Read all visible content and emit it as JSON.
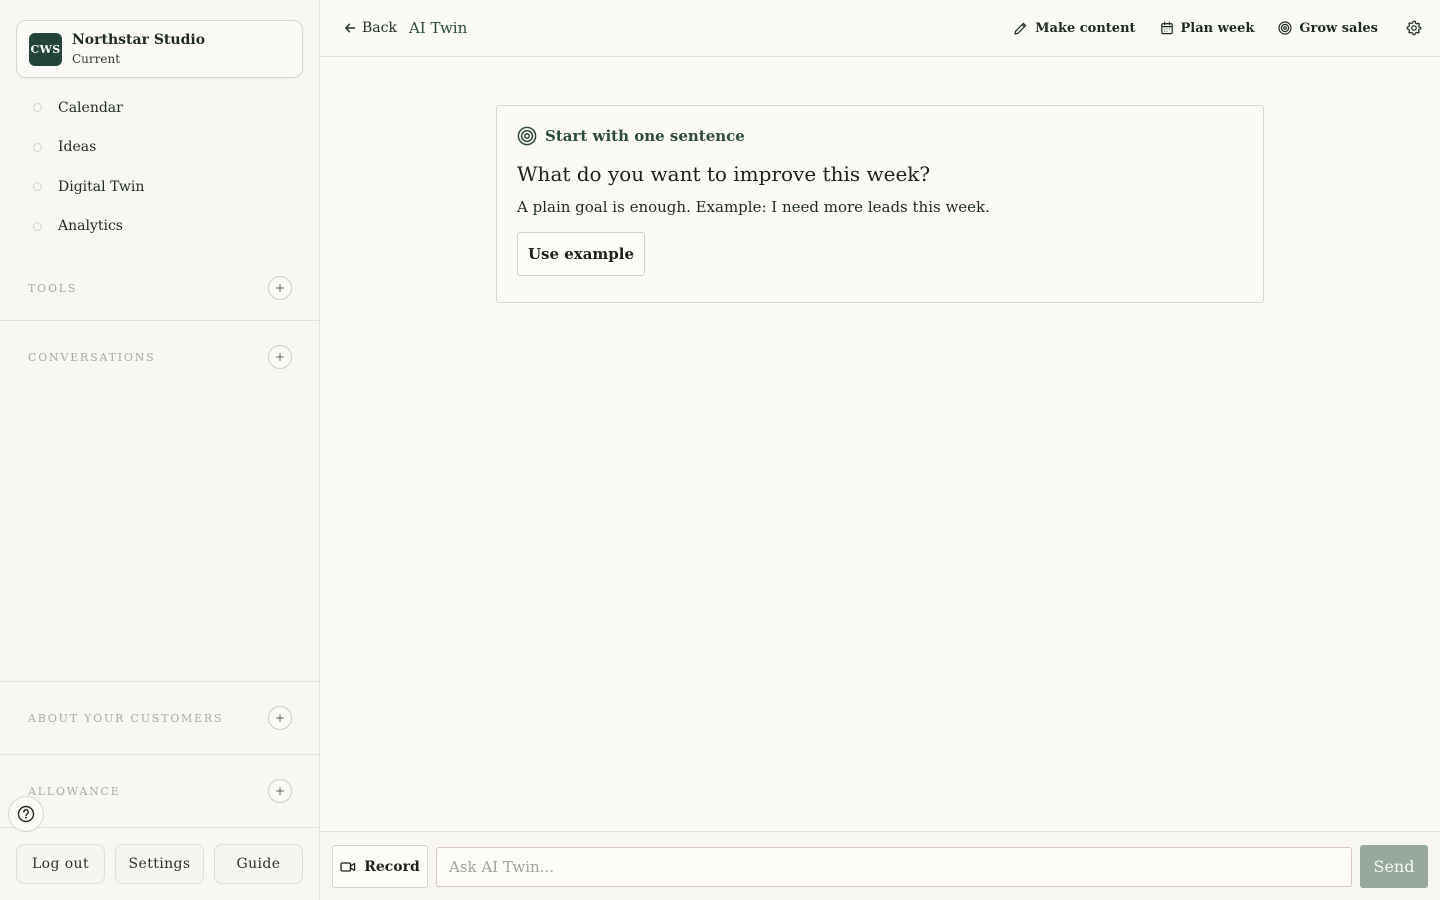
{
  "workspace": {
    "initials": "CWS",
    "name": "Northstar Studio",
    "status": "Current"
  },
  "nav": {
    "items": [
      {
        "label": "Calendar"
      },
      {
        "label": "Ideas"
      },
      {
        "label": "Digital Twin"
      },
      {
        "label": "Analytics"
      }
    ]
  },
  "sections": {
    "tools": "TOOLS",
    "conversations": "CONVERSATIONS",
    "customers": "ABOUT YOUR CUSTOMERS",
    "allowance": "ALLOWANCE",
    "plus": "+"
  },
  "footer": {
    "logout": "Log out",
    "settings": "Settings",
    "guide": "Guide"
  },
  "topbar": {
    "back": "Back",
    "title": "AI Twin",
    "actions": {
      "make_content": "Make content",
      "plan_week": "Plan week",
      "grow_sales": "Grow sales"
    }
  },
  "card": {
    "heading": "Start with one sentence",
    "question": "What do you want to improve this week?",
    "description": "A plain goal is enough. Example: I need more leads this week.",
    "button": "Use example"
  },
  "composer": {
    "record": "Record",
    "placeholder": "Ask AI Twin...",
    "send": "Send"
  },
  "colors": {
    "accent": "#22443a",
    "send_disabled": "#97a89f",
    "background": "#fafaf6"
  },
  "icons": {
    "back": "arrow-left-icon",
    "make_content": "pencil-icon",
    "plan_week": "calendar-icon",
    "grow_sales": "target-icon",
    "settings": "gear-icon",
    "help": "question-circle-icon",
    "record": "video-camera-icon"
  }
}
